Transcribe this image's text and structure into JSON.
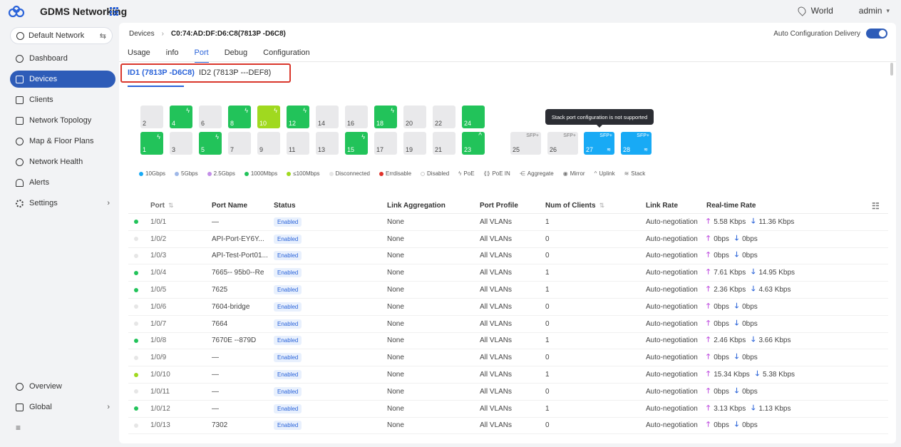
{
  "app": {
    "title": "GDMS Networking"
  },
  "topbar": {
    "region": "World",
    "user": "admin"
  },
  "sidebar": {
    "network": "Default Network",
    "items": [
      {
        "label": "Dashboard",
        "icon": "dashboard-icon"
      },
      {
        "label": "Devices",
        "icon": "devices-icon",
        "active": true
      },
      {
        "label": "Clients",
        "icon": "clients-icon"
      },
      {
        "label": "Network Topology",
        "icon": "topology-icon"
      },
      {
        "label": "Map & Floor Plans",
        "icon": "map-icon"
      },
      {
        "label": "Network Health",
        "icon": "health-icon"
      },
      {
        "label": "Alerts",
        "icon": "bell-icon"
      },
      {
        "label": "Settings",
        "icon": "gear-icon"
      }
    ],
    "bottom": [
      {
        "label": "Overview",
        "icon": "overview-icon"
      },
      {
        "label": "Global",
        "icon": "global-icon"
      }
    ]
  },
  "breadcrumb": {
    "root": "Devices",
    "device": "C0:74:AD:DF:D6:C8(7813P -D6C8)"
  },
  "auto_config": {
    "label": "Auto Configuration Delivery",
    "enabled": true
  },
  "tabs": [
    "Usage",
    "info",
    "Port",
    "Debug",
    "Configuration"
  ],
  "active_tab": "Port",
  "stack_tabs": [
    "ID1 (7813P -D6C8)",
    "ID2 (7813P ---DEF8)"
  ],
  "tooltip": "Stack port configuration is not supported",
  "ports_top": [
    {
      "num": "2",
      "state": "off"
    },
    {
      "num": "4",
      "state": "green",
      "poe": true
    },
    {
      "num": "6",
      "state": "off"
    },
    {
      "num": "8",
      "state": "green",
      "poe": true
    },
    {
      "num": "10",
      "state": "lime",
      "poe": true
    },
    {
      "num": "12",
      "state": "green",
      "poe": true
    },
    {
      "num": "14",
      "state": "off"
    },
    {
      "num": "16",
      "state": "off"
    },
    {
      "num": "18",
      "state": "green",
      "poe": true
    },
    {
      "num": "20",
      "state": "off"
    },
    {
      "num": "22",
      "state": "off"
    },
    {
      "num": "24",
      "state": "green"
    }
  ],
  "ports_bottom": [
    {
      "num": "1",
      "state": "green",
      "poe": true
    },
    {
      "num": "3",
      "state": "off"
    },
    {
      "num": "5",
      "state": "green",
      "poe": true
    },
    {
      "num": "7",
      "state": "off"
    },
    {
      "num": "9",
      "state": "off"
    },
    {
      "num": "11",
      "state": "off"
    },
    {
      "num": "13",
      "state": "off"
    },
    {
      "num": "15",
      "state": "green",
      "poe": true
    },
    {
      "num": "17",
      "state": "off"
    },
    {
      "num": "19",
      "state": "off"
    },
    {
      "num": "21",
      "state": "off"
    },
    {
      "num": "23",
      "state": "green",
      "uplink": true
    }
  ],
  "sfp_ports": [
    {
      "num": "25",
      "state": "off",
      "label": "SFP+"
    },
    {
      "num": "26",
      "state": "off",
      "label": "SFP+"
    },
    {
      "num": "27",
      "state": "blue",
      "label": "SFP+",
      "stack": true
    },
    {
      "num": "28",
      "state": "blue",
      "label": "SFP+",
      "stack": true
    }
  ],
  "legend": [
    {
      "label": "10Gbps",
      "color": "#18aaf5"
    },
    {
      "label": "5Gbps",
      "color": "#9fb8e8"
    },
    {
      "label": "2.5Gbps",
      "color": "#c38ee8"
    },
    {
      "label": "1000Mbps",
      "color": "#22c35a"
    },
    {
      "label": "≤100Mbps",
      "color": "#a0d91f"
    },
    {
      "label": "Disconnected",
      "color": "#e6e6e6"
    },
    {
      "label": "Errdisable",
      "color": "#e0312a"
    },
    {
      "label": "Disabled",
      "color": "#ffffff",
      "outline": true
    },
    {
      "label": "PoE",
      "sym": "ϟ"
    },
    {
      "label": "PoE IN",
      "sym": "⟪⟫"
    },
    {
      "label": "Aggregate",
      "sym": "⋲"
    },
    {
      "label": "Mirror",
      "sym": "◉"
    },
    {
      "label": "Uplink",
      "sym": "^"
    },
    {
      "label": "Stack",
      "sym": "≋"
    }
  ],
  "table": {
    "headers": {
      "port": "Port",
      "name": "Port Name",
      "status": "Status",
      "lag": "Link Aggregation",
      "profile": "Port Profile",
      "clients": "Num of Clients",
      "rate": "Link Rate",
      "rt": "Real-time Rate"
    },
    "rows": [
      {
        "dot": "#22c35a",
        "port": "1/0/1",
        "name": "—",
        "status": "Enabled",
        "lag": "None",
        "profile": "All VLANs",
        "clients": "1",
        "rate": "Auto-negotiation",
        "up": "5.58 Kbps",
        "down": "11.36 Kbps"
      },
      {
        "dot": "#e6e6e6",
        "port": "1/0/2",
        "name": "API-Port-EY6Y...",
        "status": "Enabled",
        "lag": "None",
        "profile": "All VLANs",
        "clients": "0",
        "rate": "Auto-negotiation",
        "up": "0bps",
        "down": "0bps"
      },
      {
        "dot": "#e6e6e6",
        "port": "1/0/3",
        "name": "API-Test-Port01...",
        "status": "Enabled",
        "lag": "None",
        "profile": "All VLANs",
        "clients": "0",
        "rate": "Auto-negotiation",
        "up": "0bps",
        "down": "0bps"
      },
      {
        "dot": "#22c35a",
        "port": "1/0/4",
        "name": "7665-- 95b0--Re",
        "status": "Enabled",
        "lag": "None",
        "profile": "All VLANs",
        "clients": "1",
        "rate": "Auto-negotiation",
        "up": "7.61 Kbps",
        "down": "14.95 Kbps"
      },
      {
        "dot": "#22c35a",
        "port": "1/0/5",
        "name": "7625",
        "status": "Enabled",
        "lag": "None",
        "profile": "All VLANs",
        "clients": "1",
        "rate": "Auto-negotiation",
        "up": "2.36 Kbps",
        "down": "4.63 Kbps"
      },
      {
        "dot": "#e6e6e6",
        "port": "1/0/6",
        "name": "7604-bridge",
        "status": "Enabled",
        "lag": "None",
        "profile": "All VLANs",
        "clients": "0",
        "rate": "Auto-negotiation",
        "up": "0bps",
        "down": "0bps"
      },
      {
        "dot": "#e6e6e6",
        "port": "1/0/7",
        "name": "7664",
        "status": "Enabled",
        "lag": "None",
        "profile": "All VLANs",
        "clients": "0",
        "rate": "Auto-negotiation",
        "up": "0bps",
        "down": "0bps"
      },
      {
        "dot": "#22c35a",
        "port": "1/0/8",
        "name": "7670E --879D",
        "status": "Enabled",
        "lag": "None",
        "profile": "All VLANs",
        "clients": "1",
        "rate": "Auto-negotiation",
        "up": "2.46 Kbps",
        "down": "3.66 Kbps"
      },
      {
        "dot": "#e6e6e6",
        "port": "1/0/9",
        "name": "—",
        "status": "Enabled",
        "lag": "None",
        "profile": "All VLANs",
        "clients": "0",
        "rate": "Auto-negotiation",
        "up": "0bps",
        "down": "0bps"
      },
      {
        "dot": "#a0d91f",
        "port": "1/0/10",
        "name": "—",
        "status": "Enabled",
        "lag": "None",
        "profile": "All VLANs",
        "clients": "1",
        "rate": "Auto-negotiation",
        "up": "15.34 Kbps",
        "down": "5.38 Kbps"
      },
      {
        "dot": "#e6e6e6",
        "port": "1/0/11",
        "name": "—",
        "status": "Enabled",
        "lag": "None",
        "profile": "All VLANs",
        "clients": "0",
        "rate": "Auto-negotiation",
        "up": "0bps",
        "down": "0bps"
      },
      {
        "dot": "#22c35a",
        "port": "1/0/12",
        "name": "—",
        "status": "Enabled",
        "lag": "None",
        "profile": "All VLANs",
        "clients": "1",
        "rate": "Auto-negotiation",
        "up": "3.13 Kbps",
        "down": "1.13 Kbps"
      },
      {
        "dot": "#e6e6e6",
        "port": "1/0/13",
        "name": "7302",
        "status": "Enabled",
        "lag": "None",
        "profile": "All VLANs",
        "clients": "0",
        "rate": "Auto-negotiation",
        "up": "0bps",
        "down": "0bps"
      }
    ]
  }
}
